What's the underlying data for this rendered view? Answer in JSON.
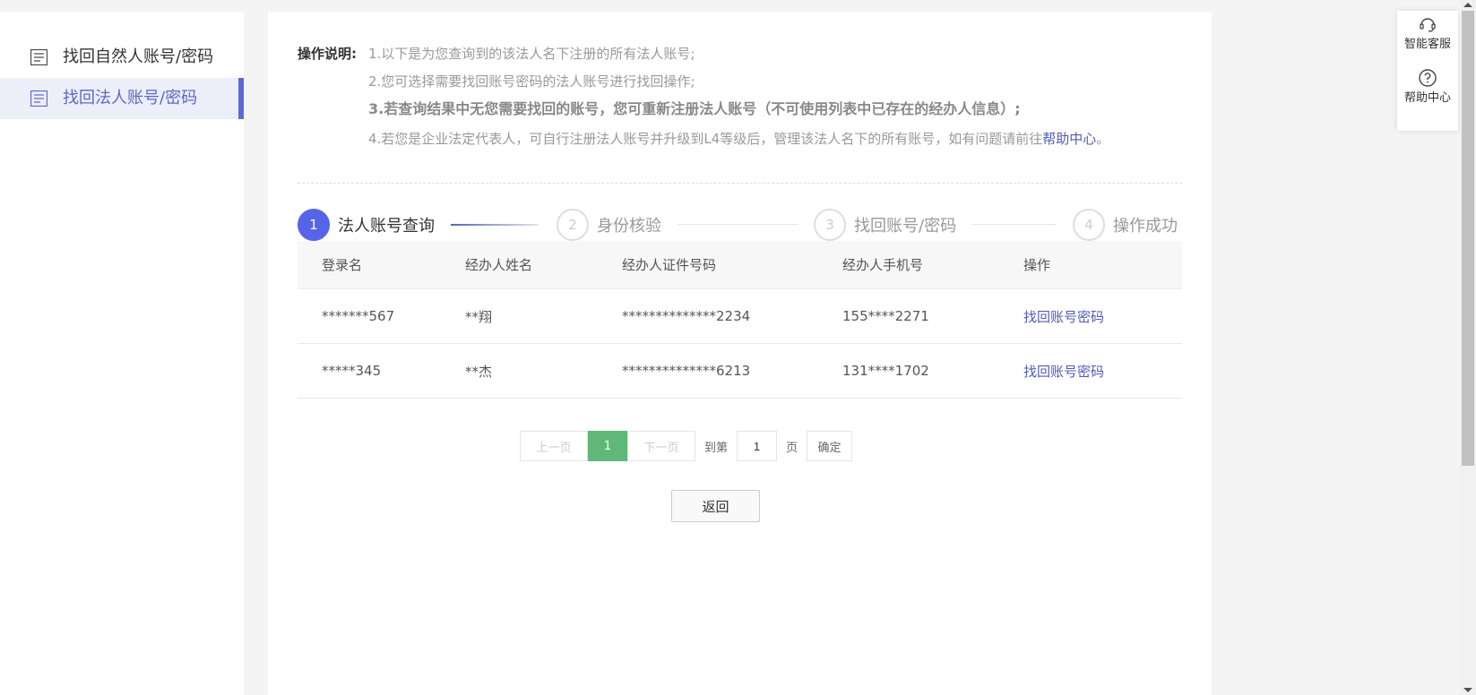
{
  "sidebar": {
    "items": [
      {
        "label": "找回自然人账号/密码",
        "icon": "document-icon",
        "active": false
      },
      {
        "label": "找回法人账号/密码",
        "icon": "document-icon",
        "active": true
      }
    ]
  },
  "instructions": {
    "heading": "操作说明:",
    "lines": [
      "1.以下是为您查询到的该法人名下注册的所有法人账号;",
      "2.您可选择需要找回账号密码的法人账号进行找回操作;",
      "3.若查询结果中无您需要找回的账号，您可重新注册法人账号（不可使用列表中已存在的经办人信息）;",
      "4.若您是企业法定代表人，可自行注册法人账号并升级到L4等级后，管理该法人名下的所有账号，如有问题请前往"
    ],
    "help_link": "帮助中心",
    "line4_suffix": "。"
  },
  "steps": [
    {
      "num": "1",
      "label": "法人账号查询",
      "active": true
    },
    {
      "num": "2",
      "label": "身份核验",
      "active": false
    },
    {
      "num": "3",
      "label": "找回账号/密码",
      "active": false
    },
    {
      "num": "4",
      "label": "操作成功",
      "active": false
    }
  ],
  "table": {
    "headers": [
      "登录名",
      "经办人姓名",
      "经办人证件号码",
      "经办人手机号",
      "操作"
    ],
    "rows": [
      {
        "login": "*******567",
        "name": "**翔",
        "id_no": "**************2234",
        "phone": "155****2271",
        "action": "找回账号密码"
      },
      {
        "login": "*****345",
        "name": "**杰",
        "id_no": "**************6213",
        "phone": "131****1702",
        "action": "找回账号密码"
      }
    ]
  },
  "pagination": {
    "prev": "上一页",
    "current": "1",
    "next": "下一页",
    "goto_prefix": "到第",
    "goto_value": "1",
    "goto_suffix": "页",
    "confirm": "确定"
  },
  "back_button": "返回",
  "float_tools": [
    {
      "label": "智能客服",
      "icon": "headset-icon"
    },
    {
      "label": "帮助中心",
      "icon": "question-circle-icon"
    }
  ],
  "colors": {
    "accent": "#5665e8",
    "sidebar_active_bg": "#eceef9",
    "link": "#4f5bb8",
    "page_active": "#5fb878"
  }
}
